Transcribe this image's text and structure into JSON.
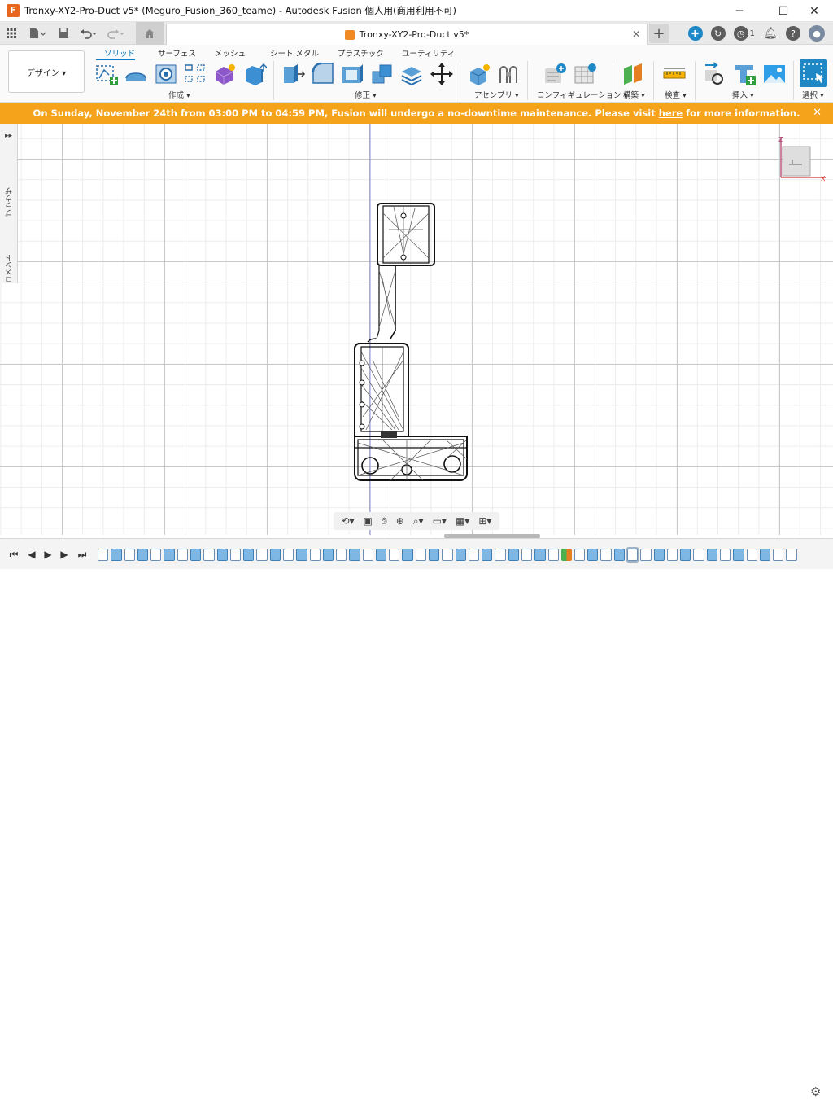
{
  "window": {
    "title": "Tronxy-XY2-Pro-Duct v5* (Meguro_Fusion_360_teame) - Autodesk Fusion 個人用(商用利用不可)",
    "minimize": "─",
    "maximize": "☐",
    "close": "✕"
  },
  "doc_tab": {
    "label": "Tronxy-XY2-Pro-Duct v5*",
    "close": "✕"
  },
  "account": {
    "jobs_count": "1"
  },
  "workspace": {
    "label": "デザイン ▾"
  },
  "ribbon_tabs": [
    "ソリッド",
    "サーフェス",
    "メッシュ",
    "シート メタル",
    "プラスチック",
    "ユーティリティ"
  ],
  "groups": {
    "create": "作成 ▾",
    "modify": "修正 ▾",
    "assemble": "アセンブリ ▾",
    "configure": "コンフィギュレーション ▾",
    "construct": "構築 ▾",
    "inspect": "検査 ▾",
    "insert": "挿入 ▾",
    "select": "選択 ▾"
  },
  "banner": {
    "text_before": "On Sunday, November 24th from 03:00 PM to 04:59 PM, Fusion will undergo a no-downtime maintenance. Please visit",
    "link": "here",
    "text_after": "for more information.",
    "close": "✕"
  },
  "side_panel": {
    "browser": "ブラウザ",
    "comments": "コメント"
  },
  "viewcube": {
    "z_label": "Z",
    "x_label": "X"
  },
  "colors": {
    "accent": "#0a7bc2",
    "banner": "#f6a31c",
    "brand": "#e8661e"
  }
}
